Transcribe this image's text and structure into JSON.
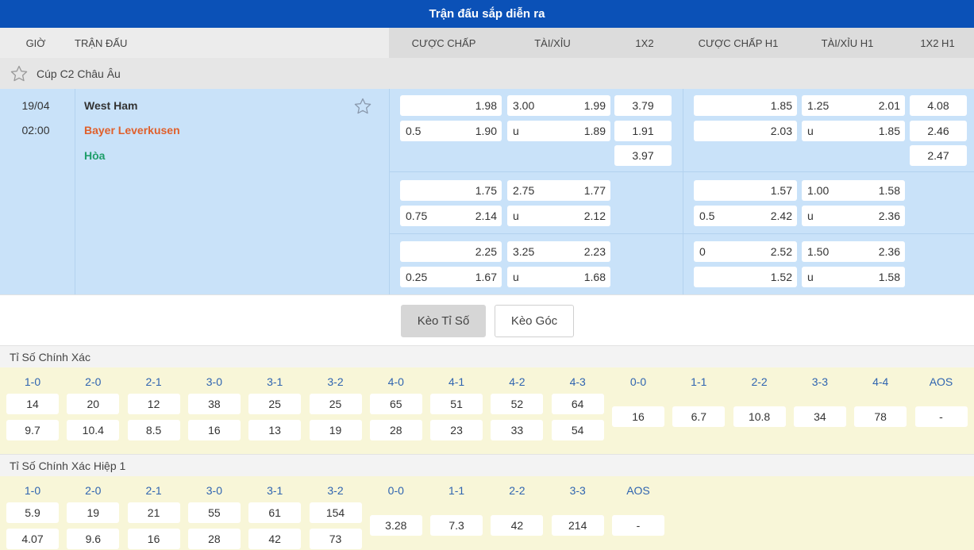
{
  "title": "Trận đấu sắp diễn ra",
  "headers": {
    "time": "GIỜ",
    "match": "TRẬN ĐẤU",
    "handicap": "CƯỢC CHẤP",
    "over_under": "TÀI/XỈU",
    "x12": "1X2",
    "handicap_h1": "CƯỢC CHẤP H1",
    "over_under_h1": "TÀI/XỈU H1",
    "x12_h1": "1X2 H1"
  },
  "league": "Cúp C2 Châu Âu",
  "match": {
    "date": "19/04",
    "time": "02:00",
    "home": "West Ham",
    "away": "Bayer Leverkusen",
    "draw": "Hòa"
  },
  "odds": [
    {
      "hc": {
        "top": [
          "",
          "1.98"
        ],
        "bot": [
          "0.5",
          "1.90"
        ]
      },
      "ou": {
        "top": [
          "3.00",
          "1.99"
        ],
        "bot": [
          "u",
          "1.89"
        ]
      },
      "x12": [
        "3.79",
        "1.91",
        "3.97"
      ],
      "hc_h1": {
        "top": [
          "",
          "1.85"
        ],
        "bot": [
          "",
          "2.03"
        ]
      },
      "ou_h1": {
        "top": [
          "1.25",
          "2.01"
        ],
        "bot": [
          "u",
          "1.85"
        ]
      },
      "x12_h1": [
        "4.08",
        "2.46",
        "2.47"
      ]
    },
    {
      "hc": {
        "top": [
          "",
          "1.75"
        ],
        "bot": [
          "0.75",
          "2.14"
        ]
      },
      "ou": {
        "top": [
          "2.75",
          "1.77"
        ],
        "bot": [
          "u",
          "2.12"
        ]
      },
      "hc_h1": {
        "top": [
          "",
          "1.57"
        ],
        "bot": [
          "0.5",
          "2.42"
        ]
      },
      "ou_h1": {
        "top": [
          "1.00",
          "1.58"
        ],
        "bot": [
          "u",
          "2.36"
        ]
      }
    },
    {
      "hc": {
        "top": [
          "",
          "2.25"
        ],
        "bot": [
          "0.25",
          "1.67"
        ]
      },
      "ou": {
        "top": [
          "3.25",
          "2.23"
        ],
        "bot": [
          "u",
          "1.68"
        ]
      },
      "hc_h1": {
        "top": [
          "0",
          "2.52"
        ],
        "bot": [
          "",
          "1.52"
        ]
      },
      "ou_h1": {
        "top": [
          "1.50",
          "2.36"
        ],
        "bot": [
          "u",
          "1.58"
        ]
      }
    }
  ],
  "tabs": [
    "Kèo Tỉ Số",
    "Kèo Góc"
  ],
  "exact_score": {
    "title": "Tỉ Số Chính Xác",
    "labels": [
      "1-0",
      "2-0",
      "2-1",
      "3-0",
      "3-1",
      "3-2",
      "4-0",
      "4-1",
      "4-2",
      "4-3",
      "0-0",
      "1-1",
      "2-2",
      "3-3",
      "4-4",
      "AOS"
    ],
    "row1": [
      "14",
      "20",
      "12",
      "38",
      "25",
      "25",
      "65",
      "51",
      "52",
      "64"
    ],
    "row2": [
      "9.7",
      "10.4",
      "8.5",
      "16",
      "13",
      "19",
      "28",
      "23",
      "33",
      "54"
    ],
    "mid": [
      "16",
      "6.7",
      "10.8",
      "34",
      "78",
      "-"
    ]
  },
  "exact_score_h1": {
    "title": "Tỉ Số Chính Xác Hiệp 1",
    "labels": [
      "1-0",
      "2-0",
      "2-1",
      "3-0",
      "3-1",
      "3-2",
      "0-0",
      "1-1",
      "2-2",
      "3-3",
      "AOS"
    ],
    "row1": [
      "5.9",
      "19",
      "21",
      "55",
      "61",
      "154"
    ],
    "row2": [
      "4.07",
      "9.6",
      "16",
      "28",
      "42",
      "73"
    ],
    "mid": [
      "3.28",
      "7.3",
      "42",
      "214",
      "-"
    ]
  },
  "colors": {
    "title_bar": "#0b51b7",
    "match_bg": "#c9e2f9",
    "score_bg": "#f8f6d8",
    "away_team": "#e0602c",
    "draw": "#1e9e6a",
    "score_label": "#2f64b0"
  },
  "icons": {
    "league_favorite": "star-outline-icon",
    "match_favorite": "star-outline-icon"
  }
}
